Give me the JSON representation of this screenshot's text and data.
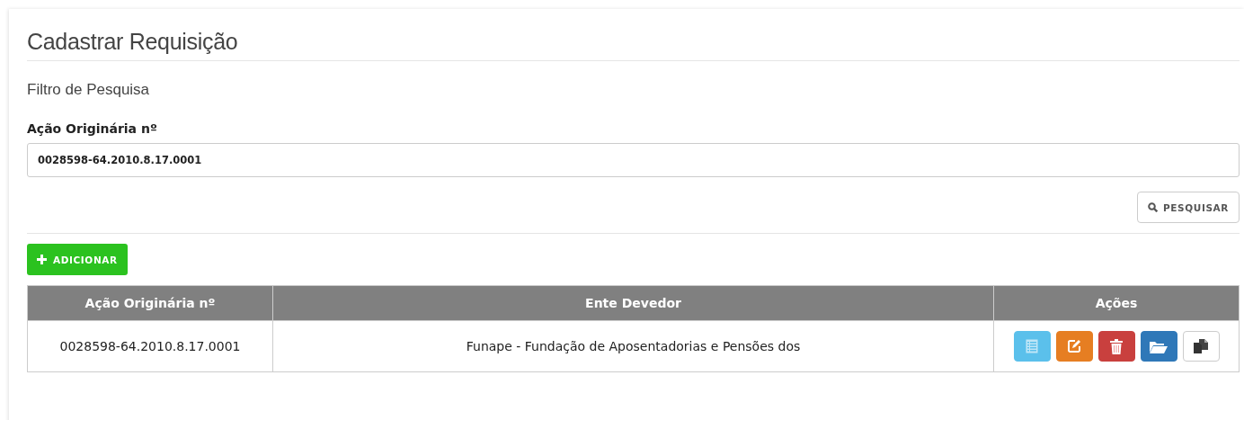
{
  "page": {
    "title": "Cadastrar Requisição"
  },
  "filter": {
    "heading": "Filtro de Pesquisa",
    "field_label": "Ação Originária nº",
    "field_value": "0028598-64.2010.8.17.0001",
    "search_button": "PESQUISAR"
  },
  "add_button": "ADICIONAR",
  "table": {
    "columns": [
      "Ação Originária nº",
      "Ente Devedor",
      "Ações"
    ],
    "rows": [
      {
        "cells": [
          "0028598-64.2010.8.17.0001",
          "Funape - Fundação de Aposentadorias e Pensões dos"
        ],
        "actions": [
          {
            "kind": "view"
          },
          {
            "kind": "edit"
          },
          {
            "kind": "delete"
          },
          {
            "kind": "open"
          },
          {
            "kind": "copy"
          }
        ]
      }
    ]
  }
}
